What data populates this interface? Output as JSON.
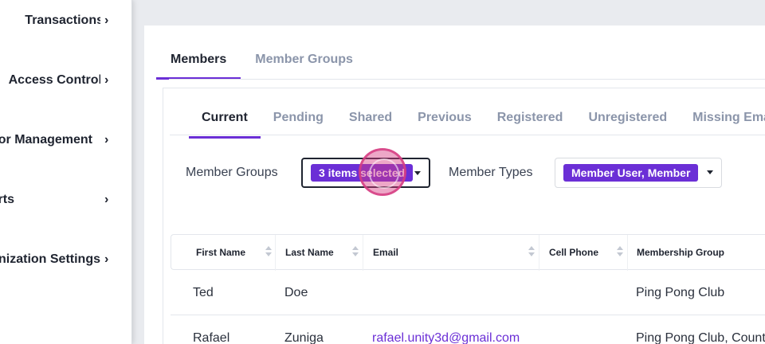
{
  "sidebar": {
    "items": [
      {
        "label": "Transactions"
      },
      {
        "label": "Access Control"
      },
      {
        "label": "Vendor Management"
      },
      {
        "label": "Reports"
      },
      {
        "label": "Organization Settings"
      }
    ],
    "chevron": "›"
  },
  "main": {
    "tabs": [
      {
        "label": "Members",
        "active": true
      },
      {
        "label": "Member Groups",
        "active": false
      }
    ],
    "sub_tabs": [
      {
        "label": "Current",
        "active": true
      },
      {
        "label": "Pending"
      },
      {
        "label": "Shared"
      },
      {
        "label": "Previous"
      },
      {
        "label": "Registered"
      },
      {
        "label": "Unregistered"
      },
      {
        "label": "Missing Email"
      }
    ],
    "filters": {
      "groups_label": "Member Groups",
      "groups_value": "3 items selected",
      "types_label": "Member Types",
      "types_value": "Member User, Member"
    },
    "table": {
      "headers": [
        "First Name",
        "Last Name",
        "Email",
        "Cell Phone",
        "Membership Group"
      ],
      "rows": [
        {
          "first": "Ted",
          "last": "Doe",
          "email": "",
          "phone": "",
          "group": "Ping Pong Club"
        },
        {
          "first": "Rafael",
          "last": "Zuniga",
          "email": "rafael.unity3d@gmail.com",
          "phone": "",
          "group": "Ping Pong Club, Country"
        }
      ]
    }
  },
  "colors": {
    "accent": "#6b2fd6",
    "click_indicator": "#d63c82"
  },
  "icons": [
    "chevron-right-icon",
    "sort-icon",
    "caret-down-icon"
  ]
}
